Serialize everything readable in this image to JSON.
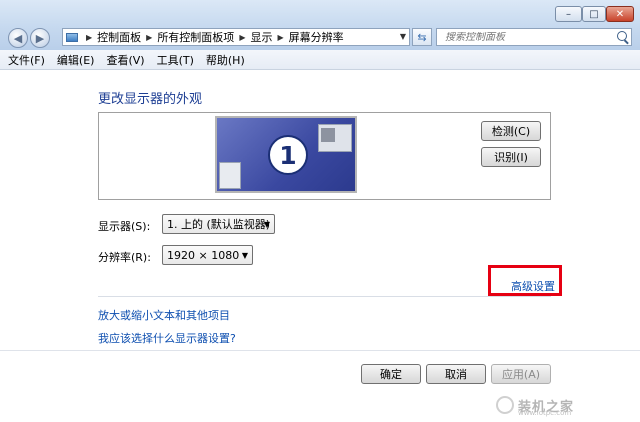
{
  "titlebar": {
    "minimize_icon": "minimize-icon",
    "maximize_icon": "maximize-icon",
    "close_icon": "close-icon",
    "minimize_glyph": "–",
    "maximize_glyph": "□",
    "close_glyph": "✕"
  },
  "address": {
    "crumbs": [
      "控制面板",
      "所有控制面板项",
      "显示",
      "屏幕分辨率"
    ],
    "search_placeholder": "搜索控制面板"
  },
  "menu": {
    "items": [
      "文件(F)",
      "编辑(E)",
      "查看(V)",
      "工具(T)",
      "帮助(H)"
    ]
  },
  "main": {
    "title": "更改显示器的外观",
    "monitor_number": "1",
    "detect_label": "检测(C)",
    "identify_label": "识别(I)",
    "display_label": "显示器(S):",
    "display_value": "1. 上的 (默认监视器)",
    "resolution_label": "分辨率(R):",
    "resolution_value": "1920 × 1080",
    "advanced_link": "高级设置",
    "link_zoom": "放大或缩小文本和其他项目",
    "link_which": "我应该选择什么显示器设置?"
  },
  "footer": {
    "ok_label": "确定",
    "cancel_label": "取消",
    "apply_label": "应用(A)"
  },
  "watermark": {
    "text": "装机之家",
    "url": "www.lotpc.com"
  },
  "colors": {
    "link": "#0e4fb0",
    "title": "#1e3f94",
    "highlight": "#e60012"
  }
}
